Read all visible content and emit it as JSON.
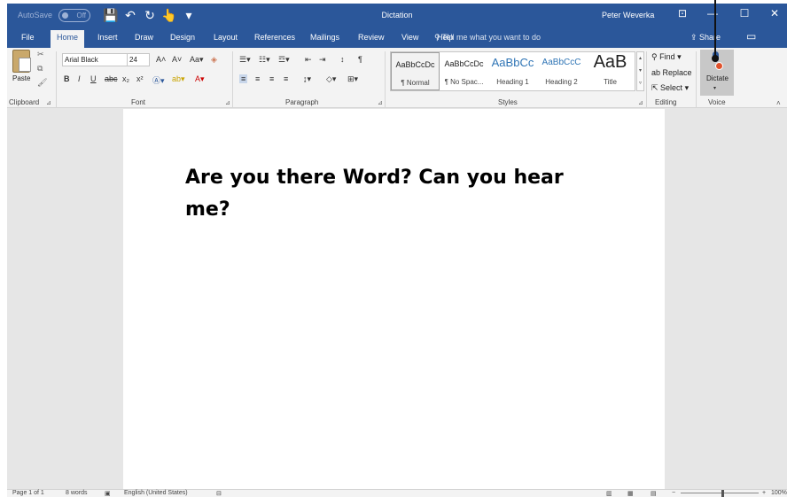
{
  "titlebar": {
    "autosave": "AutoSave",
    "autosave_state": "Off",
    "qat": [
      "💾",
      "↶",
      "↻",
      "👆",
      "▾"
    ],
    "doc_title": "Dictation",
    "user": "Peter Weverka",
    "controls": [
      "⊡",
      "—",
      "☐",
      "✕"
    ]
  },
  "tabs": [
    "File",
    "Home",
    "Insert",
    "Draw",
    "Design",
    "Layout",
    "References",
    "Mailings",
    "Review",
    "View",
    "Help"
  ],
  "active_tab": "Home",
  "tellme": "Tell me what you want to do",
  "share": "Share",
  "ribbon": {
    "clipboard": {
      "paste": "Paste",
      "label": "Clipboard"
    },
    "font": {
      "name": "Arial Black",
      "size": "24",
      "label": "Font",
      "row2": [
        "B",
        "I",
        "U",
        "abc",
        "x₂",
        "x²"
      ]
    },
    "paragraph": {
      "label": "Paragraph"
    },
    "styles": {
      "label": "Styles",
      "items": [
        {
          "sample": "AaBbCcDc",
          "name": "¶ Normal"
        },
        {
          "sample": "AaBbCcDc",
          "name": "¶ No Spac..."
        },
        {
          "sample": "AaBbCc",
          "name": "Heading 1"
        },
        {
          "sample": "AaBbCcC",
          "name": "Heading 2"
        },
        {
          "sample": "AaB",
          "name": "Title"
        }
      ]
    },
    "editing": {
      "label": "Editing",
      "find": "Find",
      "replace": "Replace",
      "select": "Select"
    },
    "voice": {
      "label": "Voice",
      "dictate": "Dictate"
    }
  },
  "document": {
    "text": "Are you there Word? Can you hear me?"
  },
  "status": {
    "page": "Page 1 of 1",
    "words": "8 words",
    "language": "English (United States)",
    "zoom": "100%"
  }
}
